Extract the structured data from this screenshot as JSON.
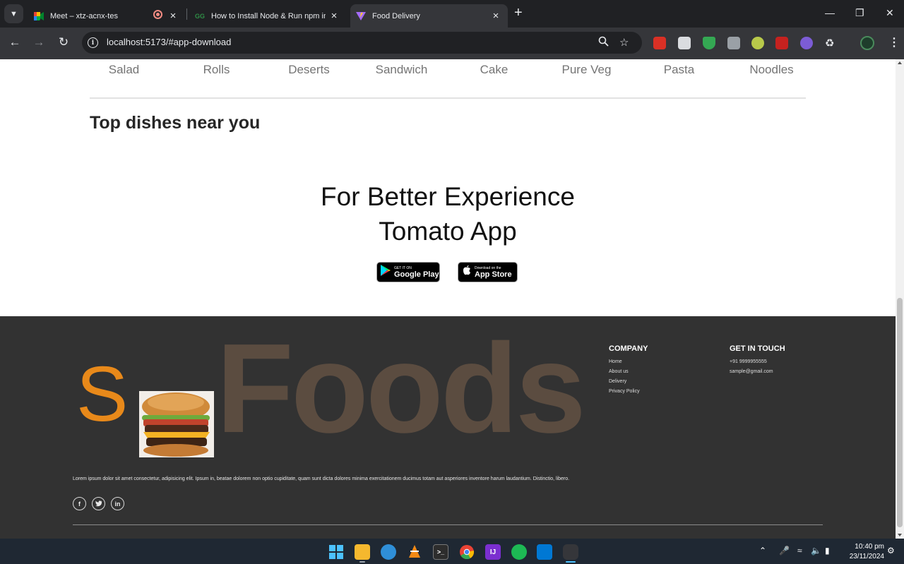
{
  "browser": {
    "tabs": [
      {
        "title": "Meet – xtz-acnx-tes",
        "icon": "google-meet-icon"
      },
      {
        "title": "How to Install Node & Run npm in",
        "icon": "geeksforgeeks-icon"
      },
      {
        "title": "Food Delivery",
        "icon": "vite-icon",
        "active": true
      }
    ],
    "url": "localhost:5173/#app-download",
    "new_tab_symbol": "+"
  },
  "page": {
    "menu_items": [
      "Salad",
      "Rolls",
      "Deserts",
      "Sandwich",
      "Cake",
      "Pure Veg",
      "Pasta",
      "Noodles"
    ],
    "section_title": "Top dishes near you",
    "app_download": {
      "heading_line1": "For Better Experience",
      "heading_line2": "Tomato App",
      "google_play": {
        "small": "GET IT ON",
        "big": "Google Play"
      },
      "app_store": {
        "small": "Download on the",
        "big": "App Store"
      }
    }
  },
  "footer": {
    "brand_initial": "S",
    "brand_word": "Foods",
    "description": "Lorem ipsum dolor sit amet consectetur, adipisicing elit. Ipsum in, beatae dolorem non optio cupiditate, quam sunt dicta dolores minima exercitationem ducimus totam aut asperiores inventore harum laudantium. Distinctio, libero.",
    "socials": [
      "f",
      "t",
      "in"
    ],
    "company": {
      "heading": "COMPANY",
      "links": [
        "Home",
        "About us",
        "Delivery",
        "Privacy Policy"
      ]
    },
    "contact": {
      "heading": "GET IN TOUCH",
      "phone": "+91 9999955555",
      "email": "sample@gmail.com"
    },
    "colors": {
      "brand_orange": "#e8891a",
      "foods_brown": "#5b4c40",
      "background": "#323232"
    }
  },
  "taskbar": {
    "time": "10:40 pm",
    "date": "23/11/2024"
  }
}
